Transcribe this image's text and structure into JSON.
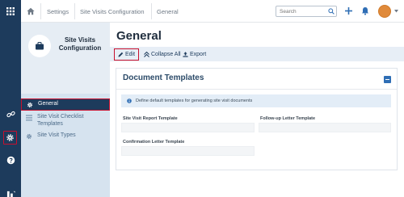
{
  "breadcrumb": {
    "items": [
      "Settings",
      "Site Visits Configuration",
      "General"
    ]
  },
  "search": {
    "placeholder": "Search",
    "value": ""
  },
  "subnav": {
    "title": "Site Visits Configuration",
    "items": [
      {
        "label": "General",
        "icon": "gear-icon",
        "selected": true
      },
      {
        "label": "Site Visit Checklist Templates",
        "icon": "list-icon",
        "selected": false
      },
      {
        "label": "Site Visit Types",
        "icon": "gear-icon",
        "selected": false
      }
    ]
  },
  "page": {
    "title": "General"
  },
  "toolbar": {
    "edit_label": "Edit",
    "collapse_label": "Collapse All",
    "export_label": "Export"
  },
  "panel": {
    "title": "Document Templates",
    "info": "Define default templates for generating site visit documents",
    "fields": {
      "report_label": "Site Visit Report Template",
      "followup_label": "Follow-up Letter Template",
      "confirm_label": "Confirmation Letter Template"
    }
  },
  "colors": {
    "rail": "#1d3b5c",
    "accent": "#2f6eb5",
    "highlight": "#c8102e",
    "avatar": "#e08a3a"
  }
}
